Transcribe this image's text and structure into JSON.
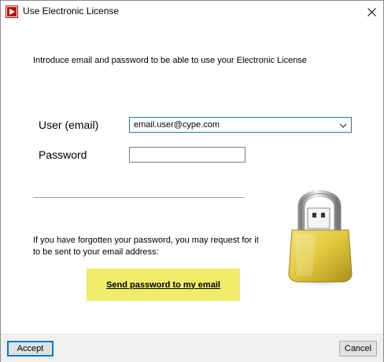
{
  "window": {
    "title": "Use Electronic License",
    "close_glyph": "✕"
  },
  "intro": "Introduce email and password to be able to use your Electronic License",
  "form": {
    "user_label": "User (email)",
    "user_value": "email.user@cype.com",
    "password_label": "Password",
    "password_value": ""
  },
  "forgot": {
    "text": "If you have forgotten your password, you may request for it to be sent to your email address:",
    "send_label": "Send password to my email"
  },
  "footer": {
    "accept_label": "Accept",
    "cancel_label": "Cancel"
  },
  "icons": {
    "app": "app-icon",
    "close": "close-icon",
    "dropdown": "chevron-down-icon",
    "lock": "padlock-usb-icon"
  },
  "colors": {
    "send_button_bg": "#f0ed6b",
    "accent": "#0078d7",
    "lock_gold": "#e0c63c"
  }
}
